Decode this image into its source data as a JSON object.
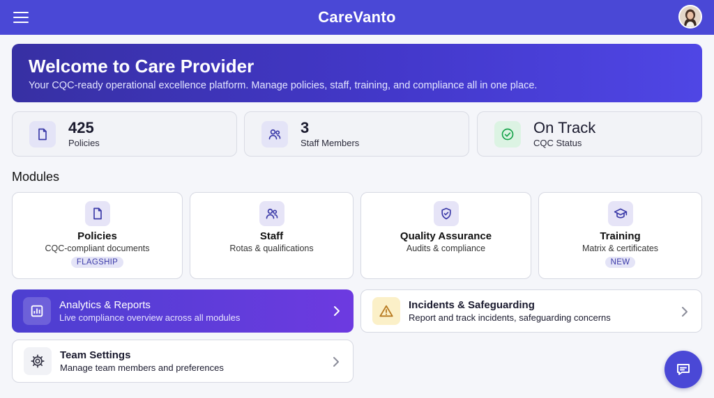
{
  "app": {
    "title": "CareVanto"
  },
  "hero": {
    "title": "Welcome to Care Provider",
    "subtitle": "Your CQC-ready operational excellence platform. Manage policies, staff, training, and compliance all in one place."
  },
  "stats": [
    {
      "value": "425",
      "label": "Policies",
      "icon": "document-icon"
    },
    {
      "value": "3",
      "label": "Staff Members",
      "icon": "users-icon"
    },
    {
      "value": "On Track",
      "label": "CQC Status",
      "icon": "check-circle-icon"
    }
  ],
  "modules_title": "Modules",
  "modules": [
    {
      "name": "Policies",
      "description": "CQC-compliant documents",
      "badge": "FLAGSHIP",
      "icon": "document-icon"
    },
    {
      "name": "Staff",
      "description": "Rotas & qualifications",
      "badge": "",
      "icon": "users-icon"
    },
    {
      "name": "Quality Assurance",
      "description": "Audits & compliance",
      "badge": "",
      "icon": "shield-check-icon"
    },
    {
      "name": "Training",
      "description": "Matrix & certificates",
      "badge": "NEW",
      "icon": "graduation-cap-icon"
    }
  ],
  "actions": {
    "analytics": {
      "title": "Analytics & Reports",
      "description": "Live compliance overview across all modules",
      "icon": "bar-chart-icon"
    },
    "incidents": {
      "title": "Incidents & Safeguarding",
      "description": "Report and track incidents, safeguarding concerns",
      "icon": "warning-icon"
    },
    "settings": {
      "title": "Team Settings",
      "description": "Manage team members and preferences",
      "icon": "gear-icon"
    }
  },
  "colors": {
    "primary": "#4a48d6",
    "hero": "#4338ca",
    "success": "#16a34a",
    "warning": "#b7791f"
  }
}
